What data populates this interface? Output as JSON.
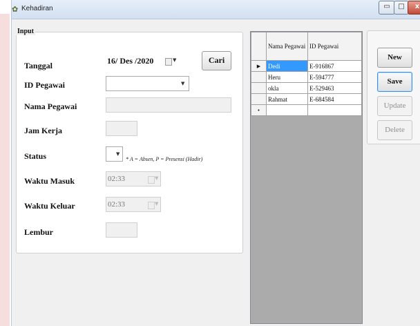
{
  "window": {
    "title": "Kehadiran",
    "controls": {
      "minimize": "▭",
      "maximize": "□",
      "close": "x"
    }
  },
  "input_group": {
    "title": "Input",
    "labels": {
      "tanggal": "Tanggal",
      "id_pegawai": "ID Pegawai",
      "nama_pegawai": "Nama Pegawai",
      "jam_kerja": "Jam Kerja",
      "status": "Status",
      "waktu_masuk": "Waktu Masuk",
      "waktu_keluar": "Waktu Keluar",
      "lembur": "Lembur"
    },
    "values": {
      "tanggal": "16/ Des /2020",
      "id_pegawai": "",
      "nama_pegawai": "",
      "jam_kerja": "",
      "status": "",
      "waktu_masuk": "02:33",
      "waktu_keluar": "02:33",
      "lembur": ""
    },
    "status_note": "* A = Absen, P = Presensi (Hadir)",
    "cari_label": "Cari"
  },
  "grid": {
    "headers": [
      "Nama Pegawai",
      "ID Pegawai"
    ],
    "rows": [
      {
        "marker": "▶",
        "nama": "Dedi",
        "id": "E-916867"
      },
      {
        "marker": "",
        "nama": "Heru",
        "id": "E-594777"
      },
      {
        "marker": "",
        "nama": "okla",
        "id": "E-529463"
      },
      {
        "marker": "",
        "nama": "Rahmat",
        "id": "E-684584"
      },
      {
        "marker": "•",
        "nama": "",
        "id": ""
      }
    ]
  },
  "actions": {
    "new": "New",
    "save": "Save",
    "update": "Update",
    "delete": "Delete"
  },
  "colors": {
    "selection": "#3399ff",
    "window_bg": "#f0f0f0"
  }
}
